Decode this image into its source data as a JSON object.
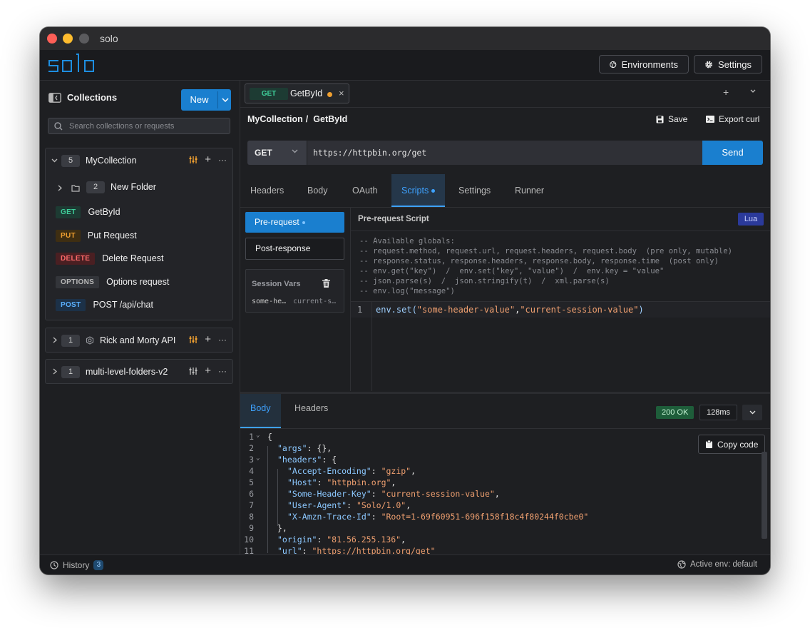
{
  "window": {
    "title": "solo"
  },
  "appbar": {
    "logo": "solo",
    "environments_label": "Environments",
    "settings_label": "Settings"
  },
  "sidebar": {
    "title": "Collections",
    "new_label": "New",
    "search_placeholder": "Search collections or requests",
    "collections": [
      {
        "count": "5",
        "name": "MyCollection",
        "folder": {
          "count": "2",
          "name": "New Folder"
        },
        "requests": [
          {
            "method": "GET",
            "name": "GetById",
            "color": "#3fcf9a",
            "bg": "#1d3b33"
          },
          {
            "method": "PUT",
            "name": "Put Request",
            "color": "#f0a030",
            "bg": "#3e2e12"
          },
          {
            "method": "DELETE",
            "name": "Delete Request",
            "color": "#ff6b6b",
            "bg": "#4a1f22"
          },
          {
            "method": "OPTIONS",
            "name": "Options request",
            "color": "#b8b8b8",
            "bg": "#33353a"
          },
          {
            "method": "POST",
            "name": "POST /api/chat",
            "color": "#5ab0ff",
            "bg": "#1c3148"
          }
        ]
      },
      {
        "count": "1",
        "name": "Rick and Morty API"
      },
      {
        "count": "1",
        "name": "multi-level-folders-v2"
      }
    ]
  },
  "tab": {
    "method": "GET",
    "name": "GetById",
    "plus": "+"
  },
  "breadcrumb": {
    "collection": "MyCollection",
    "separator": "/",
    "request": "GetById"
  },
  "actions": {
    "save": "Save",
    "export": "Export curl"
  },
  "request": {
    "method": "GET",
    "url": "https://httpbin.org/get",
    "send": "Send"
  },
  "subtabs": [
    "Headers",
    "Body",
    "OAuth",
    "Scripts",
    "Settings",
    "Runner"
  ],
  "scripts": {
    "pre_label": "Pre-request",
    "post_label": "Post-response",
    "session_vars_title": "Session Vars",
    "session_key": "some-he…",
    "session_value": "current-s…",
    "editor_title": "Pre-request Script",
    "language": "Lua",
    "comments": "-- Available globals:\n-- request.method, request.url, request.headers, request.body  (pre only, mutable)\n-- response.status, response.headers, response.body, response.time  (post only)\n-- env.get(\"key\")  /  env.set(\"key\", \"value\")  /  env.key = \"value\"\n-- json.parse(s)  /  json.stringify(t)  /  xml.parse(s)\n-- env.log(\"message\")",
    "code_line_number": "1",
    "code_fn": "env.set(",
    "code_arg1": "\"some-header-value\"",
    "code_comma": ",",
    "code_arg2": "\"current-session-value\"",
    "code_close": ")"
  },
  "response": {
    "tabs": [
      "Body",
      "Headers"
    ],
    "status": "200 OK",
    "time": "128ms",
    "copy_label": "Copy code",
    "lines": [
      {
        "n": "1",
        "fold": true,
        "k": "",
        "p": "{",
        "v": "",
        "e": ""
      },
      {
        "n": "2",
        "fold": false,
        "k": "\"args\"",
        "p": ": {},",
        "v": "",
        "e": ""
      },
      {
        "n": "3",
        "fold": true,
        "k": "\"headers\"",
        "p": ": {",
        "v": "",
        "e": ""
      },
      {
        "n": "4",
        "fold": false,
        "k": "\"Accept-Encoding\"",
        "p": ": ",
        "v": "\"gzip\"",
        "e": ","
      },
      {
        "n": "5",
        "fold": false,
        "k": "\"Host\"",
        "p": ": ",
        "v": "\"httpbin.org\"",
        "e": ","
      },
      {
        "n": "6",
        "fold": false,
        "k": "\"Some-Header-Key\"",
        "p": ": ",
        "v": "\"current-session-value\"",
        "e": ","
      },
      {
        "n": "7",
        "fold": false,
        "k": "\"User-Agent\"",
        "p": ": ",
        "v": "\"Solo/1.0\"",
        "e": ","
      },
      {
        "n": "8",
        "fold": false,
        "k": "\"X-Amzn-Trace-Id\"",
        "p": ": ",
        "v": "\"Root=1-69f60951-696f158f18c4f80244f0cbe0\"",
        "e": ""
      },
      {
        "n": "9",
        "fold": false,
        "k": "",
        "p": "},",
        "v": "",
        "e": ""
      },
      {
        "n": "10",
        "fold": false,
        "k": "\"origin\"",
        "p": ": ",
        "v": "\"81.56.255.136\"",
        "e": ","
      },
      {
        "n": "11",
        "fold": false,
        "k": "\"url\"",
        "p": ": ",
        "v": "\"https://httpbin.org/get\"",
        "e": ""
      }
    ]
  },
  "statusbar": {
    "history_label": "History",
    "history_count": "3",
    "active_env": "Active env: default"
  },
  "colors": {
    "accent": "#1a7fcf",
    "active_tab": "#3ea2ff",
    "unsaved_dot": "#f0a030"
  }
}
